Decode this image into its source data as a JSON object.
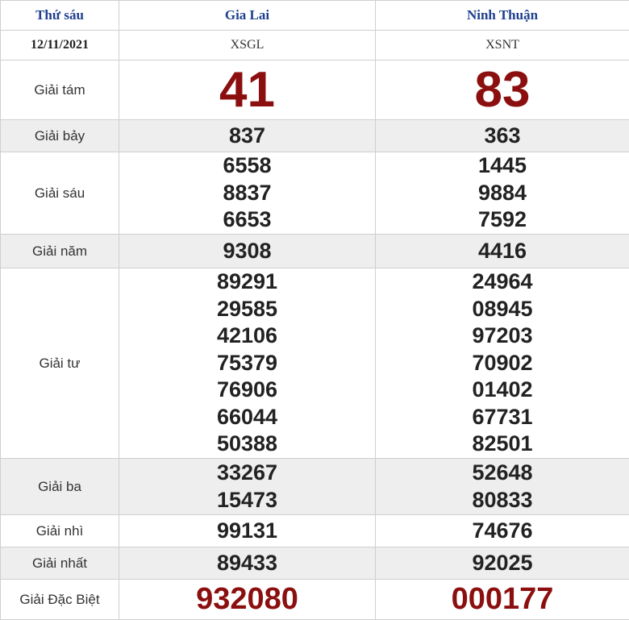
{
  "header": {
    "day": "Thứ sáu",
    "province_1": "Gia Lai",
    "province_2": "Ninh Thuận",
    "date": "12/11/2021",
    "code_1": "XSGL",
    "code_2": "XSNT"
  },
  "prizes": {
    "g8": {
      "label": "Giải tám",
      "p1": [
        "41"
      ],
      "p2": [
        "83"
      ]
    },
    "g7": {
      "label": "Giải bảy",
      "p1": [
        "837"
      ],
      "p2": [
        "363"
      ]
    },
    "g6": {
      "label": "Giải sáu",
      "p1": [
        "6558",
        "8837",
        "6653"
      ],
      "p2": [
        "1445",
        "9884",
        "7592"
      ]
    },
    "g5": {
      "label": "Giải năm",
      "p1": [
        "9308"
      ],
      "p2": [
        "4416"
      ]
    },
    "g4": {
      "label": "Giải tư",
      "p1": [
        "89291",
        "29585",
        "42106",
        "75379",
        "76906",
        "66044",
        "50388"
      ],
      "p2": [
        "24964",
        "08945",
        "97203",
        "70902",
        "01402",
        "67731",
        "82501"
      ]
    },
    "g3": {
      "label": "Giải ba",
      "p1": [
        "33267",
        "15473"
      ],
      "p2": [
        "52648",
        "80833"
      ]
    },
    "g2": {
      "label": "Giải nhì",
      "p1": [
        "99131"
      ],
      "p2": [
        "74676"
      ]
    },
    "g1": {
      "label": "Giải nhất",
      "p1": [
        "89433"
      ],
      "p2": [
        "92025"
      ]
    },
    "db": {
      "label": "Giải Đặc Biệt",
      "p1": [
        "932080"
      ],
      "p2": [
        "000177"
      ]
    }
  }
}
